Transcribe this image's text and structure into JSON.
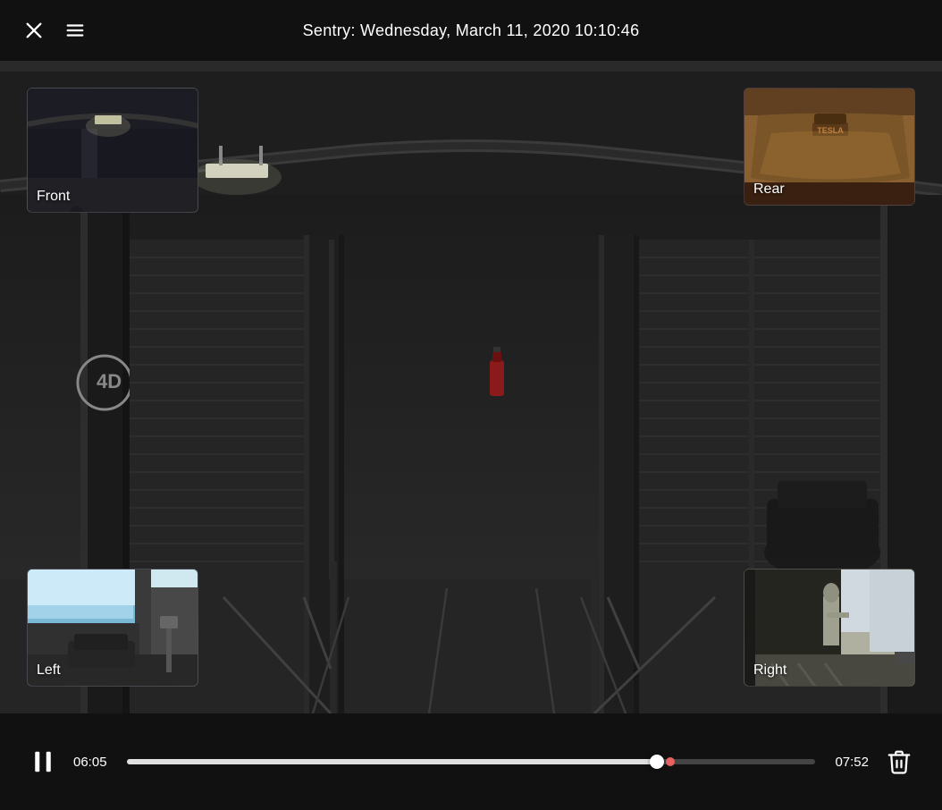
{
  "header": {
    "title": "Sentry: Wednesday, March 11, 2020 10:10:46",
    "close_label": "close",
    "menu_label": "menu"
  },
  "cameras": {
    "front": {
      "label": "Front"
    },
    "rear": {
      "label": "Rear"
    },
    "left": {
      "label": "Left"
    },
    "right": {
      "label": "Right"
    }
  },
  "controls": {
    "current_time": "06:05",
    "total_time": "07:52",
    "progress_percent": 77,
    "play_pause_state": "playing",
    "delete_label": "delete"
  }
}
